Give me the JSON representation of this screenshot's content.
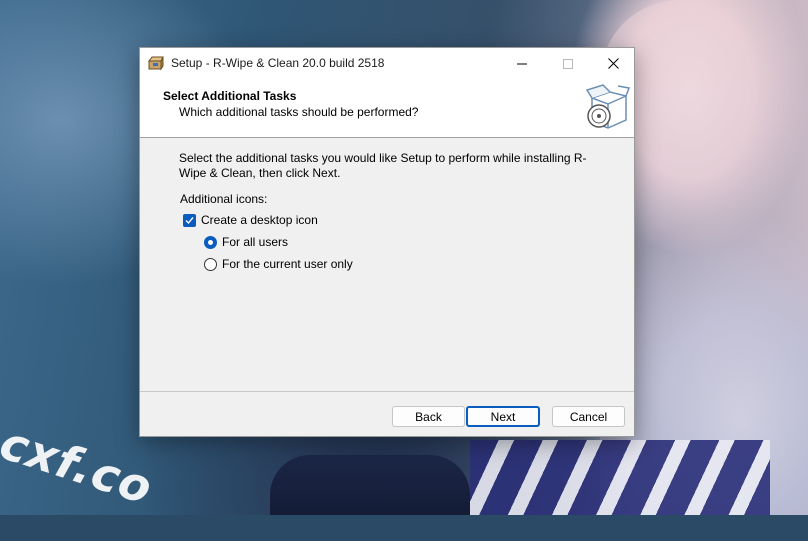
{
  "window": {
    "title": "Setup - R-Wipe & Clean 20.0 build 2518"
  },
  "header": {
    "title": "Select Additional Tasks",
    "subtitle": "Which additional tasks should be performed?"
  },
  "content": {
    "description": "Select the additional tasks you would like Setup to perform while installing R-Wipe & Clean, then click Next.",
    "section_label": "Additional icons:",
    "desktop_icon_label": "Create a desktop icon",
    "desktop_icon_checked": true,
    "radio_all_users": "For all users",
    "radio_current_user": "For the current user only",
    "selected_option": "For all users"
  },
  "buttons": {
    "back": "Back",
    "next": "Next",
    "cancel": "Cancel"
  },
  "watermark": "cxf.co",
  "icons": [
    "setup-app-icon",
    "minimize-icon",
    "maximize-icon",
    "close-icon",
    "installer-box-icon",
    "checkmark-icon"
  ],
  "colors": {
    "accent": "#0b5cbf",
    "dialog_bg": "#f0f0f0",
    "header_bg": "#ffffff"
  }
}
